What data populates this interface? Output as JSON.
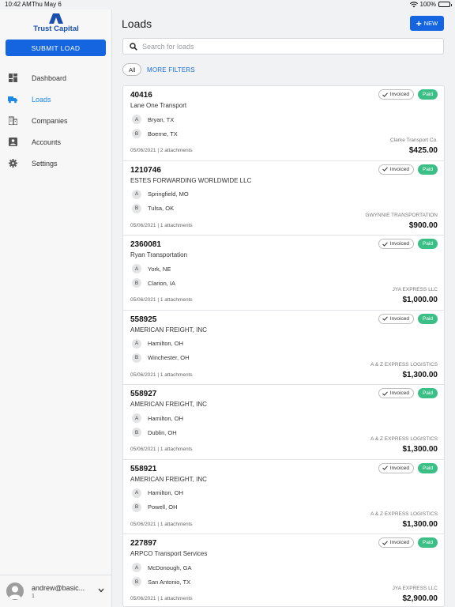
{
  "status": {
    "time": "10:42 AM",
    "date": "Thu May 6",
    "battery": "100%"
  },
  "sidebar": {
    "brand": "Trust Capital",
    "submit_label": "SUBMIT LOAD",
    "items": [
      {
        "label": "Dashboard",
        "icon": "dashboard-icon"
      },
      {
        "label": "Loads",
        "icon": "truck-icon",
        "active": true
      },
      {
        "label": "Companies",
        "icon": "building-icon"
      },
      {
        "label": "Accounts",
        "icon": "account-box-icon"
      },
      {
        "label": "Settings",
        "icon": "gear-icon"
      }
    ],
    "user": {
      "email": "andrew@basic...",
      "sub": "1"
    }
  },
  "main": {
    "title": "Loads",
    "new_label": "NEW",
    "search_placeholder": "Search for loads",
    "filter_all": "All",
    "more_filters": "MORE FILTERS",
    "loads": [
      {
        "number": "40416",
        "carrier": "Lane One Transport",
        "origin": "Bryan, TX",
        "destination": "Boerne, TX",
        "meta": "05/06/2021 | 2 attachments",
        "payee": "Clarke Transport Co.",
        "amount": "$425.00",
        "status1": "Invoiced",
        "status2": "Paid"
      },
      {
        "number": "1210746",
        "carrier": "ESTES FORWARDING WORLDWIDE LLC",
        "origin": "Springfield, MO",
        "destination": "Tulsa, OK",
        "meta": "05/06/2021 | 1 attachments",
        "payee": "GWYNNIE TRANSPORTATION",
        "amount": "$900.00",
        "status1": "Invoiced",
        "status2": "Paid"
      },
      {
        "number": "2360081",
        "carrier": "Ryan Transportation",
        "origin": "York, NE",
        "destination": "Clarion, IA",
        "meta": "05/06/2021 | 1 attachments",
        "payee": "JYA EXPRESS LLC",
        "amount": "$1,000.00",
        "status1": "Invoiced",
        "status2": "Paid"
      },
      {
        "number": "558925",
        "carrier": "AMERICAN FREIGHT, INC",
        "origin": "Hamilton, OH",
        "destination": "Winchester, OH",
        "meta": "05/06/2021 | 1 attachments",
        "payee": "A & Z EXPRESS LOGISTICS",
        "amount": "$1,300.00",
        "status1": "Invoiced",
        "status2": "Paid"
      },
      {
        "number": "558927",
        "carrier": "AMERICAN FREIGHT, INC",
        "origin": "Hamilton, OH",
        "destination": "Dublin, OH",
        "meta": "05/06/2021 | 1 attachments",
        "payee": "A & Z EXPRESS LOGISTICS",
        "amount": "$1,300.00",
        "status1": "Invoiced",
        "status2": "Paid"
      },
      {
        "number": "558921",
        "carrier": "AMERICAN FREIGHT, INC",
        "origin": "Hamilton, OH",
        "destination": "Powell, OH",
        "meta": "05/06/2021 | 1 attachments",
        "payee": "A & Z EXPRESS LOGISTICS",
        "amount": "$1,300.00",
        "status1": "Invoiced",
        "status2": "Paid"
      },
      {
        "number": "227897",
        "carrier": "ARPCO Transport Services",
        "origin": "McDonough, GA",
        "destination": "San Antonio, TX",
        "meta": "05/06/2021 | 1 attachments",
        "payee": "JYA EXPRESS LLC",
        "amount": "$2,900.00",
        "status1": "Invoiced",
        "status2": "Paid"
      }
    ]
  },
  "colors": {
    "primary": "#1565e0",
    "active_nav": "#1e88e5",
    "paid": "#3cbf86",
    "brand": "#1a4fb0"
  }
}
